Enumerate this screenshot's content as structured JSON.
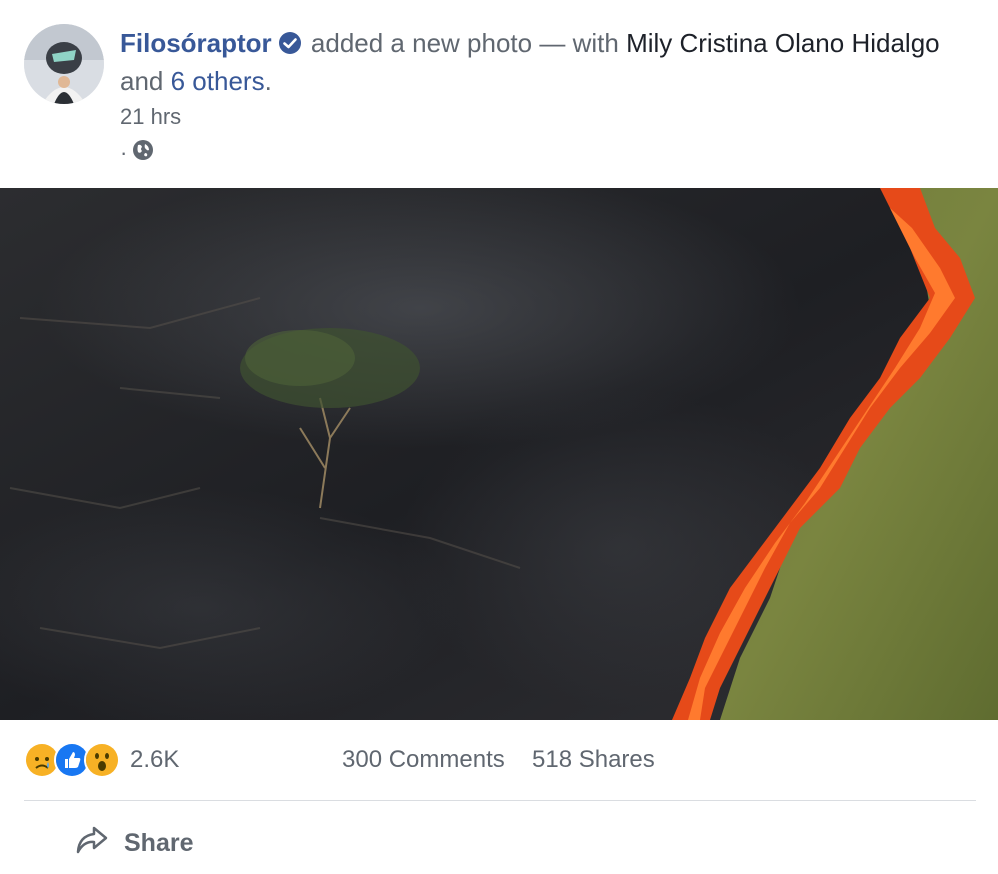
{
  "post": {
    "author": "Filosóraptor",
    "action": "added a new photo",
    "separator": "—",
    "with_word": "with",
    "tagged_main": "Mily Cristina Olano Hidalgo",
    "and_word": "and",
    "others": "6 others",
    "period": ".",
    "timestamp": "21 hrs",
    "privacy_dot": "·",
    "privacy_icon": "globe-icon"
  },
  "engagement": {
    "reactions": [
      "sad",
      "like",
      "wow"
    ],
    "reaction_count": "2.6K",
    "comments": "300 Comments",
    "shares": "518 Shares"
  },
  "actions": {
    "share_label": "Share",
    "share_icon": "share-arrow-icon"
  },
  "colors": {
    "link": "#385898",
    "muted": "#606770",
    "like": "#1877f2",
    "emoji": "#f7b125",
    "fire": "#e64a19"
  }
}
